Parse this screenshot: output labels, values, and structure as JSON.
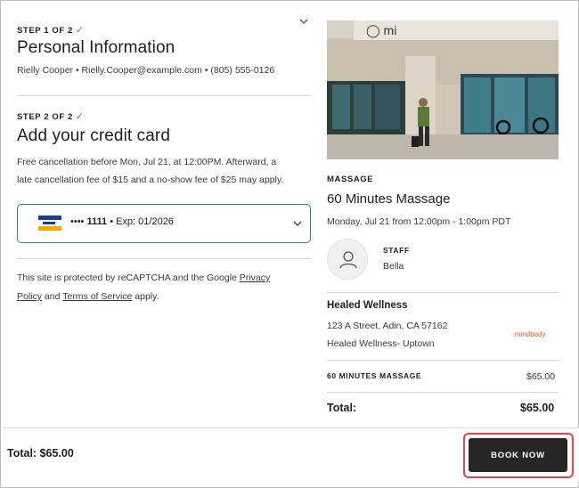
{
  "step1": {
    "label": "STEP 1 OF 2",
    "title": "Personal Information",
    "details": "Rielly Cooper • Rielly.Cooper@example.com • (805) 555-0126"
  },
  "step2": {
    "label": "STEP 2 OF 2",
    "title": "Add your credit card",
    "cancellation_line1": "Free cancellation before Mon, Jul 21, at 12:00PM. Afterward, a",
    "cancellation_line2": "late cancellation fee of $15 and a no-show fee of $25 may apply."
  },
  "card": {
    "dots": "••••",
    "last4": "1111",
    "expiry": "• Exp: 01/2026"
  },
  "recaptcha": {
    "line1_prefix": "This site is protected by reCAPTCHA and the Google ",
    "privacy_part1": "Privacy",
    "privacy_part2": "Policy",
    "and": " and ",
    "terms": "Terms of Service",
    "suffix": " apply."
  },
  "booking": {
    "category": "MASSAGE",
    "service": "60 Minutes Massage",
    "datetime": "Monday, Jul 21 from 12:00pm - 1:00pm PDT",
    "staff_label": "STAFF",
    "staff_name": "Bella",
    "business_name": "Healed Wellness",
    "address": "123 A Street, Adin, CA 57162",
    "location": "Healed Wellness- Uptown",
    "brand": "mindbody",
    "line_item_name": "60 MINUTES MASSAGE",
    "line_item_price": "$65.00",
    "total_label": "Total:",
    "total_value": "$65.00"
  },
  "footer": {
    "total": "Total: $65.00",
    "book_button": "BOOK NOW"
  },
  "colors": {
    "accent_green": "#2f8b6a",
    "check_green": "#3d9a6e",
    "button_dark": "#262626",
    "highlight_red": "#e0474a",
    "brand_orange": "#e4572e"
  }
}
